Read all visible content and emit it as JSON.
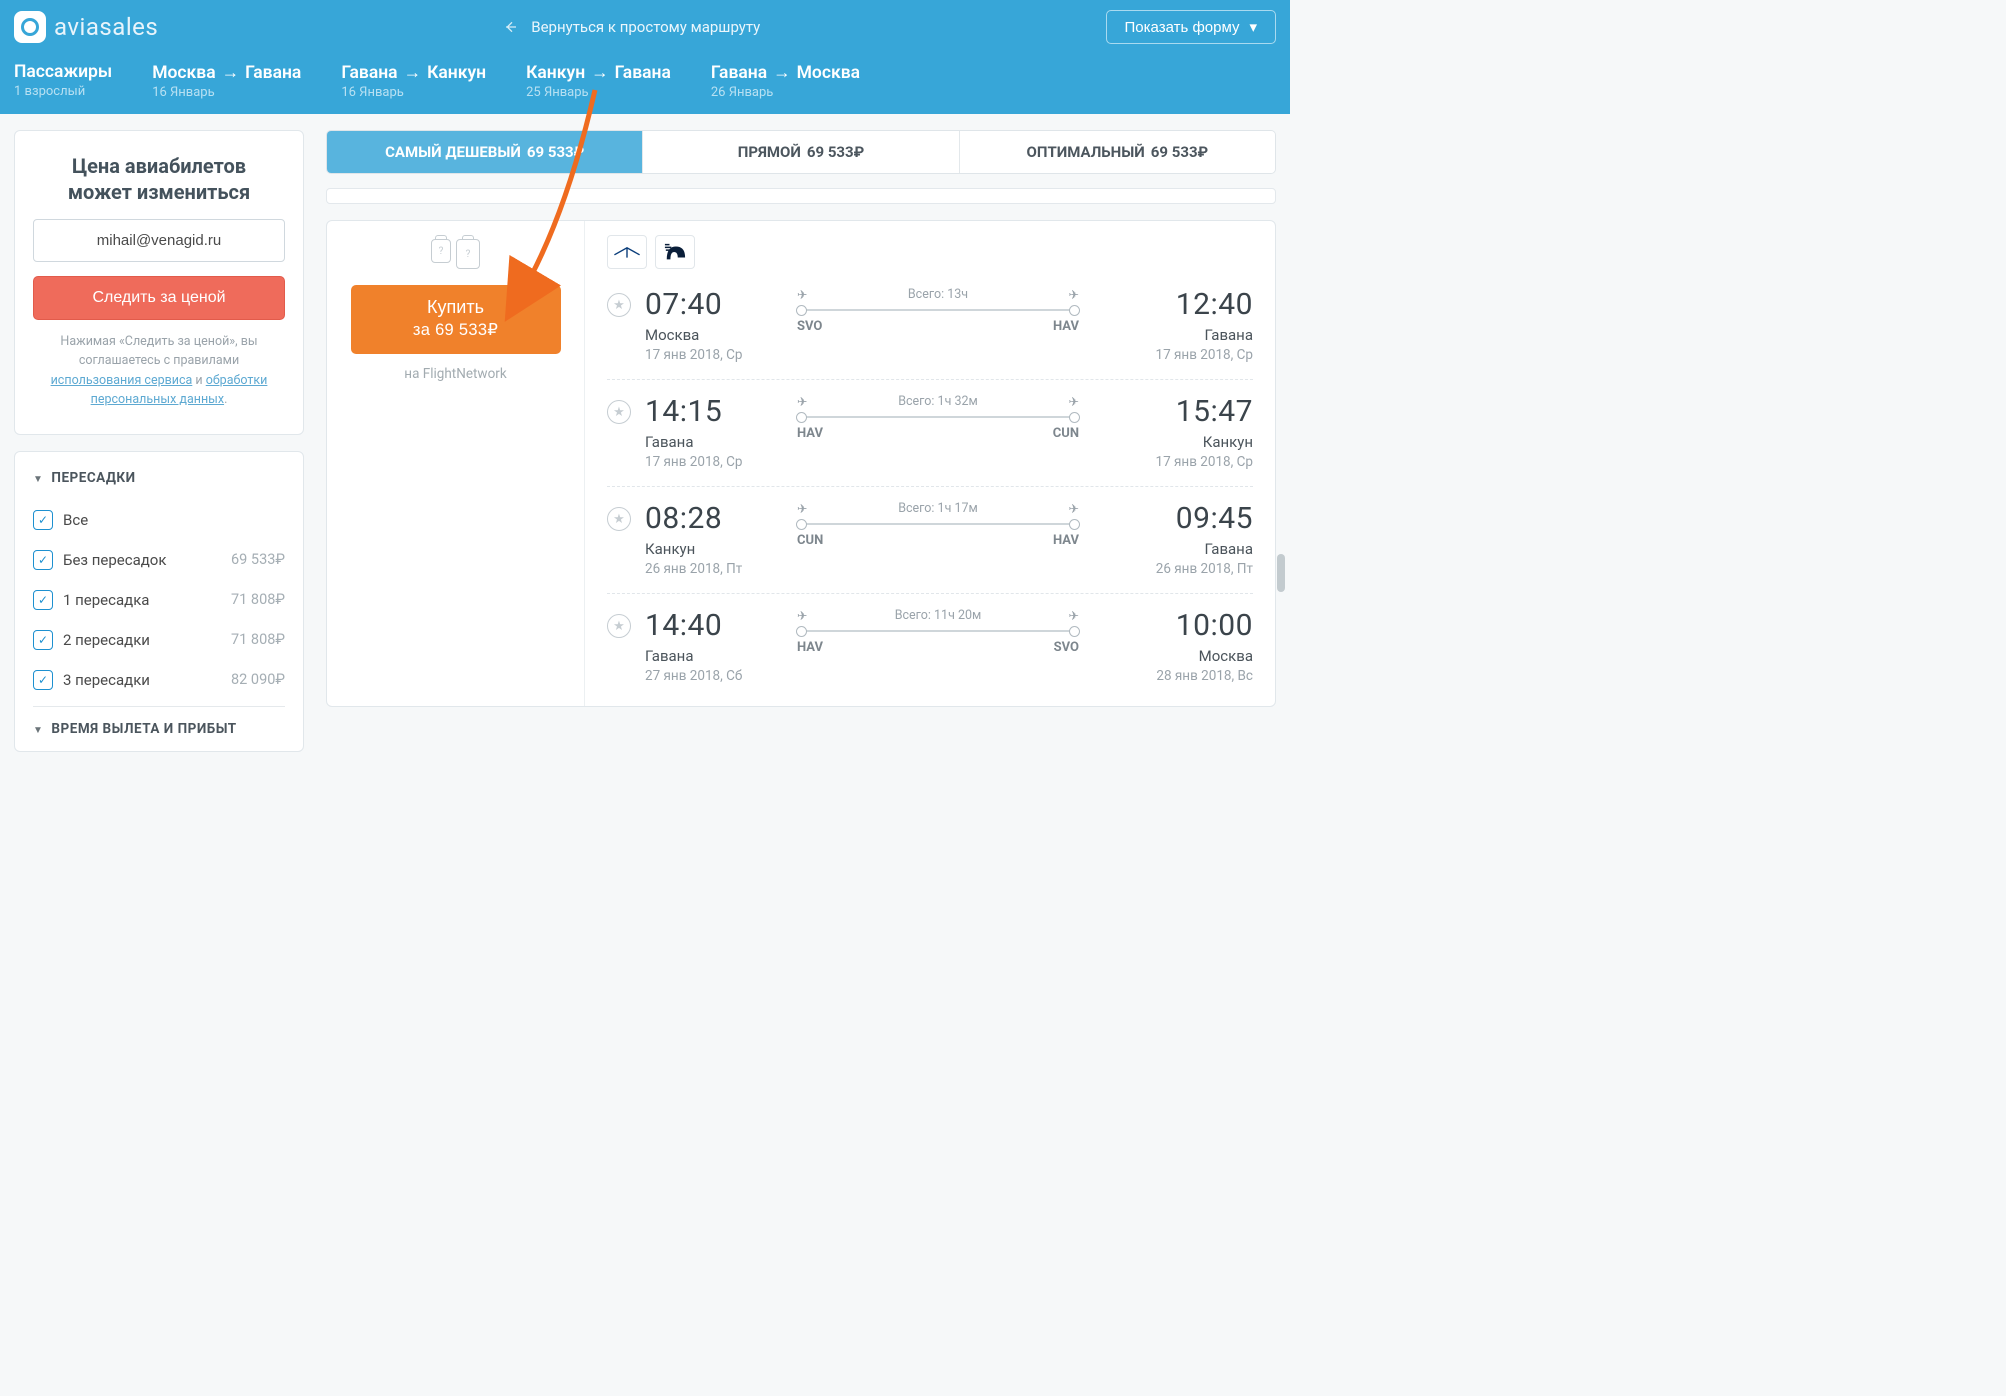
{
  "header": {
    "brand": "aviasales",
    "simple_route": "Вернуться к простому маршруту",
    "show_form": "Показать форму"
  },
  "route": {
    "passengers_label": "Пассажиры",
    "passengers_value": "1 взрослый",
    "segments": [
      {
        "from": "Москва",
        "to": "Гавана",
        "date": "16 Январь"
      },
      {
        "from": "Гавана",
        "to": "Канкун",
        "date": "16 Январь"
      },
      {
        "from": "Канкун",
        "to": "Гавана",
        "date": "25 Январь"
      },
      {
        "from": "Гавана",
        "to": "Москва",
        "date": "26 Январь"
      }
    ]
  },
  "subscribe": {
    "title_l1": "Цена авиабилетов",
    "title_l2": "может измениться",
    "email_value": "mihail@venagid.ru",
    "track_label": "Следить за ценой",
    "legal_pre": "Нажимая «Следить за ценой», вы соглашаетесь с правилами ",
    "legal_link1": "использования сервиса",
    "legal_and": " и ",
    "legal_link2": "обработки персональных данных",
    "legal_post": "."
  },
  "filters": {
    "stops_title": "ПЕРЕСАДКИ",
    "time_title": "ВРЕМЯ ВЫЛЕТА И ПРИБЫТ",
    "stops": [
      {
        "label": "Все",
        "price": ""
      },
      {
        "label": "Без пересадок",
        "price": "69 533₽"
      },
      {
        "label": "1 пересадка",
        "price": "71 808₽"
      },
      {
        "label": "2 пересадки",
        "price": "71 808₽"
      },
      {
        "label": "3 пересадки",
        "price": "82 090₽"
      }
    ]
  },
  "tabs": [
    {
      "label": "САМЫЙ ДЕШЕВЫЙ",
      "price": "69 533₽",
      "active": true
    },
    {
      "label": "ПРЯМОЙ",
      "price": "69 533₽",
      "active": false
    },
    {
      "label": "ОПТИМАЛЬНЫЙ",
      "price": "69 533₽",
      "active": false
    }
  ],
  "buy": {
    "action": "Купить",
    "price_line": "за 69 533₽",
    "gate_prefix": "на ",
    "gate": "FlightNetwork"
  },
  "segments": [
    {
      "dep_time": "07:40",
      "dep_city": "Москва",
      "dep_date": "17 янв 2018, Ср",
      "arr_time": "12:40",
      "arr_city": "Гавана",
      "arr_date": "17 янв 2018, Ср",
      "dep_code": "SVO",
      "arr_code": "HAV",
      "duration": "Всего: 13ч"
    },
    {
      "dep_time": "14:15",
      "dep_city": "Гавана",
      "dep_date": "17 янв 2018, Ср",
      "arr_time": "15:47",
      "arr_city": "Канкун",
      "arr_date": "17 янв 2018, Ср",
      "dep_code": "HAV",
      "arr_code": "CUN",
      "duration": "Всего: 1ч 32м"
    },
    {
      "dep_time": "08:28",
      "dep_city": "Канкун",
      "dep_date": "26 янв 2018, Пт",
      "arr_time": "09:45",
      "arr_city": "Гавана",
      "arr_date": "26 янв 2018, Пт",
      "dep_code": "CUN",
      "arr_code": "HAV",
      "duration": "Всего: 1ч 17м"
    },
    {
      "dep_time": "14:40",
      "dep_city": "Гавана",
      "dep_date": "27 янв 2018, Сб",
      "arr_time": "10:00",
      "arr_city": "Москва",
      "arr_date": "28 янв 2018, Вс",
      "dep_code": "HAV",
      "arr_code": "SVO",
      "duration": "Всего: 11ч 20м"
    }
  ]
}
